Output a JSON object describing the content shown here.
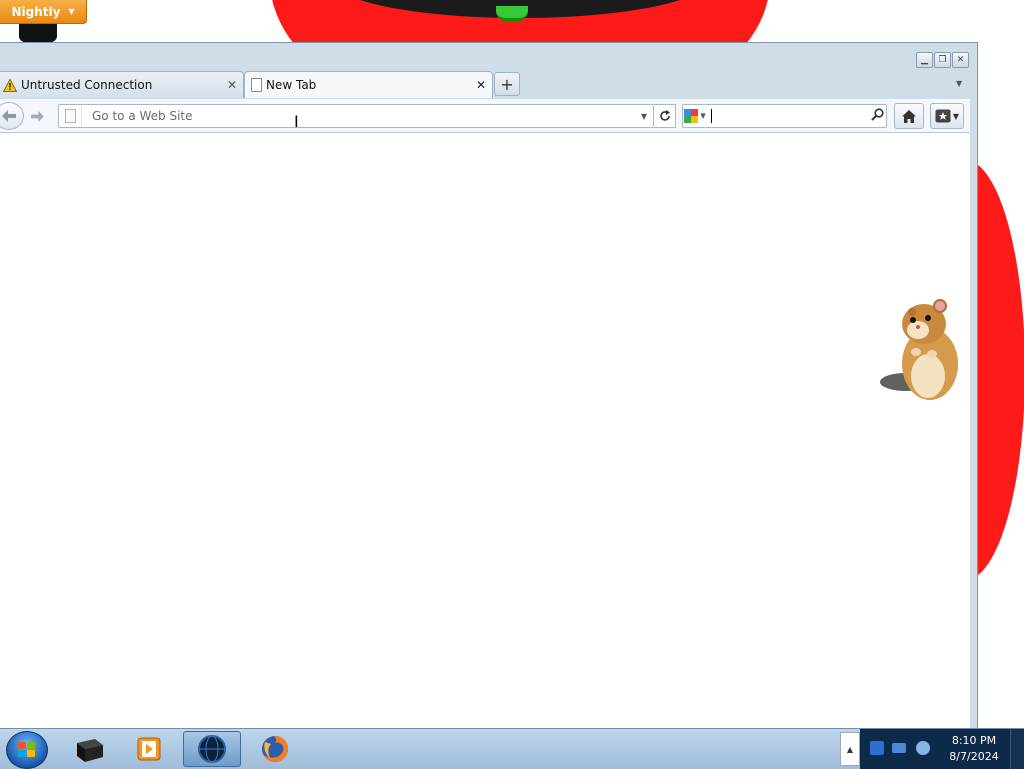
{
  "window": {
    "app_menu_label": "Nightly",
    "controls": [
      "minimize",
      "restore",
      "close"
    ]
  },
  "tabs": [
    {
      "label": "Untrusted Connection",
      "icon": "warning-icon",
      "active": false
    },
    {
      "label": "New Tab",
      "icon": "page-icon",
      "active": true
    }
  ],
  "navbar": {
    "url_placeholder": "Go to a Web Site",
    "url_value": "",
    "search_value": "",
    "search_engine": "google-icon"
  },
  "taskbar": {
    "items": [
      "start-orb",
      "dark-box-app",
      "media-player",
      "globe-app-active",
      "firefox"
    ],
    "clock_time": "8:10 PM",
    "clock_date": "8/7/2024"
  },
  "colors": {
    "accent_orange": "#e88912",
    "desktop_red": "#ff1a1a",
    "taskbar_blue": "#9fbcd9"
  }
}
